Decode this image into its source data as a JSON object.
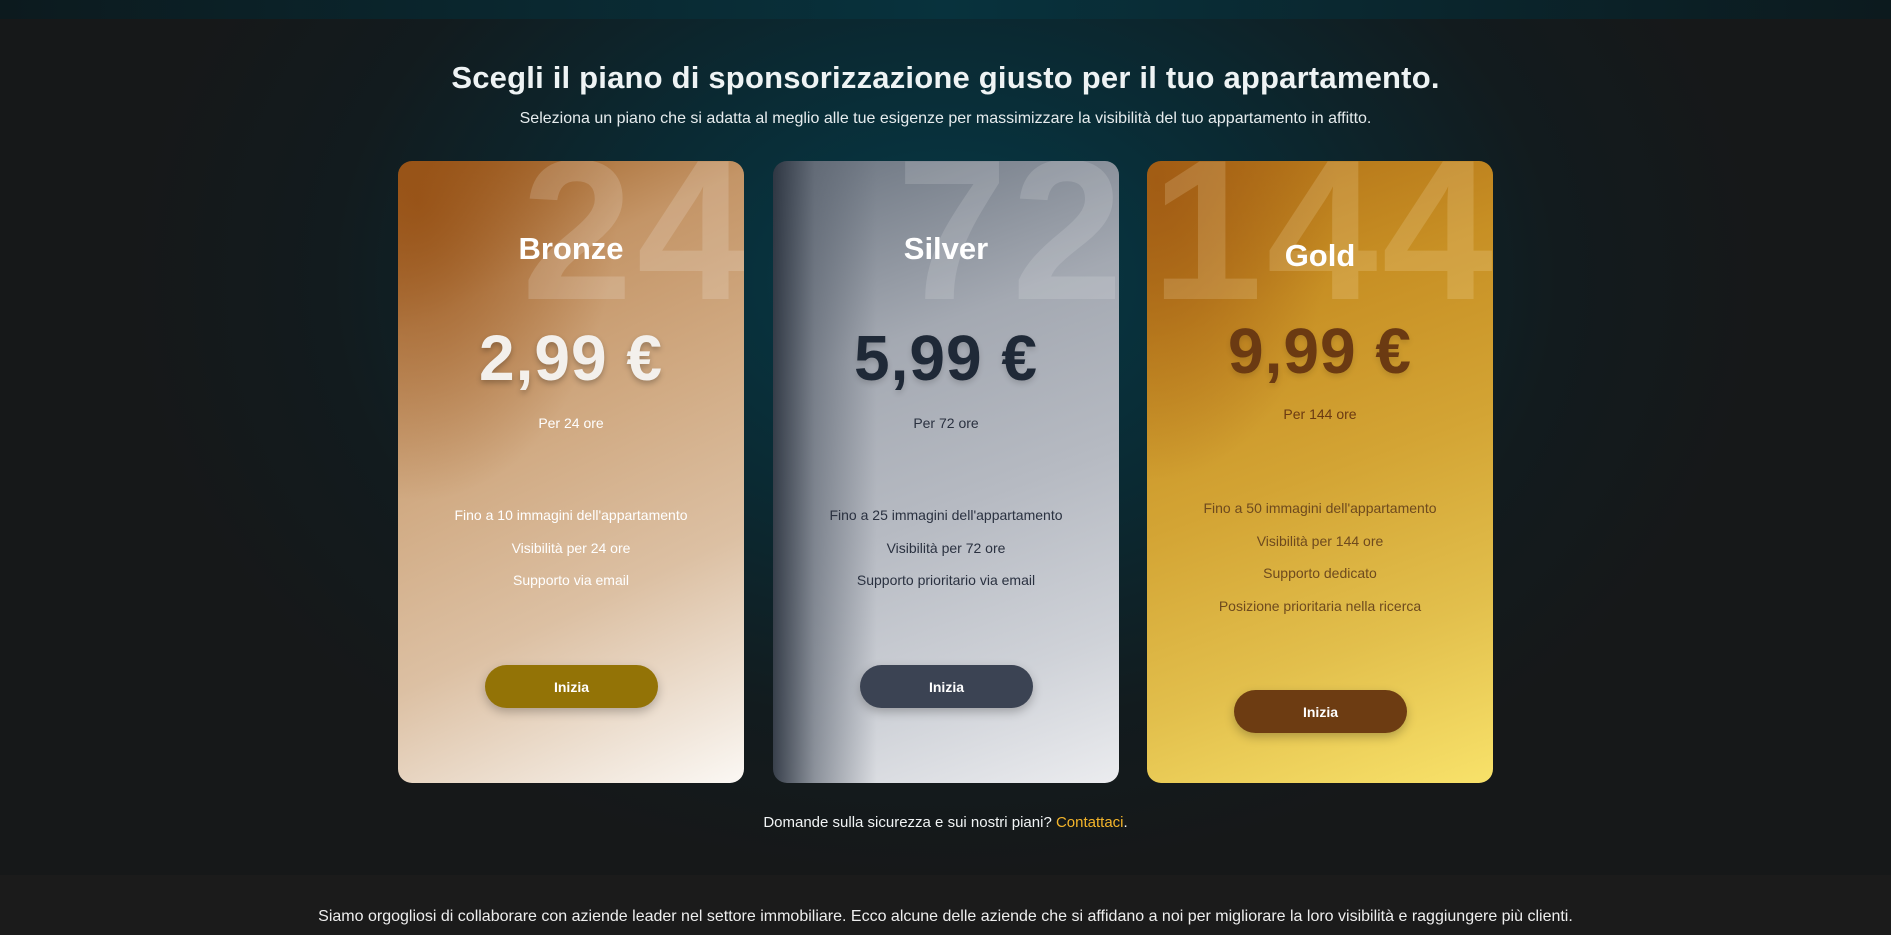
{
  "header": {
    "title": "Scegli il piano di sponsorizzazione giusto per il tuo appartamento.",
    "subtitle": "Seleziona un piano che si adatta al meglio alle tue esigenze per massimizzare la visibilità del tuo appartamento in affitto."
  },
  "plans": [
    {
      "watermark": "24",
      "name": "Bronze",
      "price": "2,99 €",
      "period": "Per 24 ore",
      "features": [
        "Fino a 10 immagini dell'appartamento",
        "Visibilità per 24 ore",
        "Supporto via email"
      ],
      "button_label": "Inizia",
      "button_color": "#937306"
    },
    {
      "watermark": "72",
      "name": "Silver",
      "price": "5,99 €",
      "period": "Per 72 ore",
      "features": [
        "Fino a 25 immagini dell'appartamento",
        "Visibilità per 72 ore",
        "Supporto prioritario via email"
      ],
      "button_label": "Inizia",
      "button_color": "#3b4353"
    },
    {
      "watermark": "144",
      "name": "Gold",
      "price": "9,99 €",
      "period": "Per 144 ore",
      "features": [
        "Fino a 50 immagini dell'appartamento",
        "Visibilità per 144 ore",
        "Supporto dedicato",
        "Posizione prioritaria nella ricerca"
      ],
      "button_label": "Inizia",
      "button_color": "#6d3c12"
    }
  ],
  "contact": {
    "text": "Domande sulla sicurezza e sui nostri piani?",
    "link_label": "Contattaci",
    "suffix": ".",
    "link_color": "#f4b52a"
  },
  "partners": {
    "text": "Siamo orgogliosi di collaborare con aziende leader nel settore immobiliare. Ecco alcune delle aziende che si affidano a noi per migliorare la loro visibilità e raggiungere più clienti."
  }
}
